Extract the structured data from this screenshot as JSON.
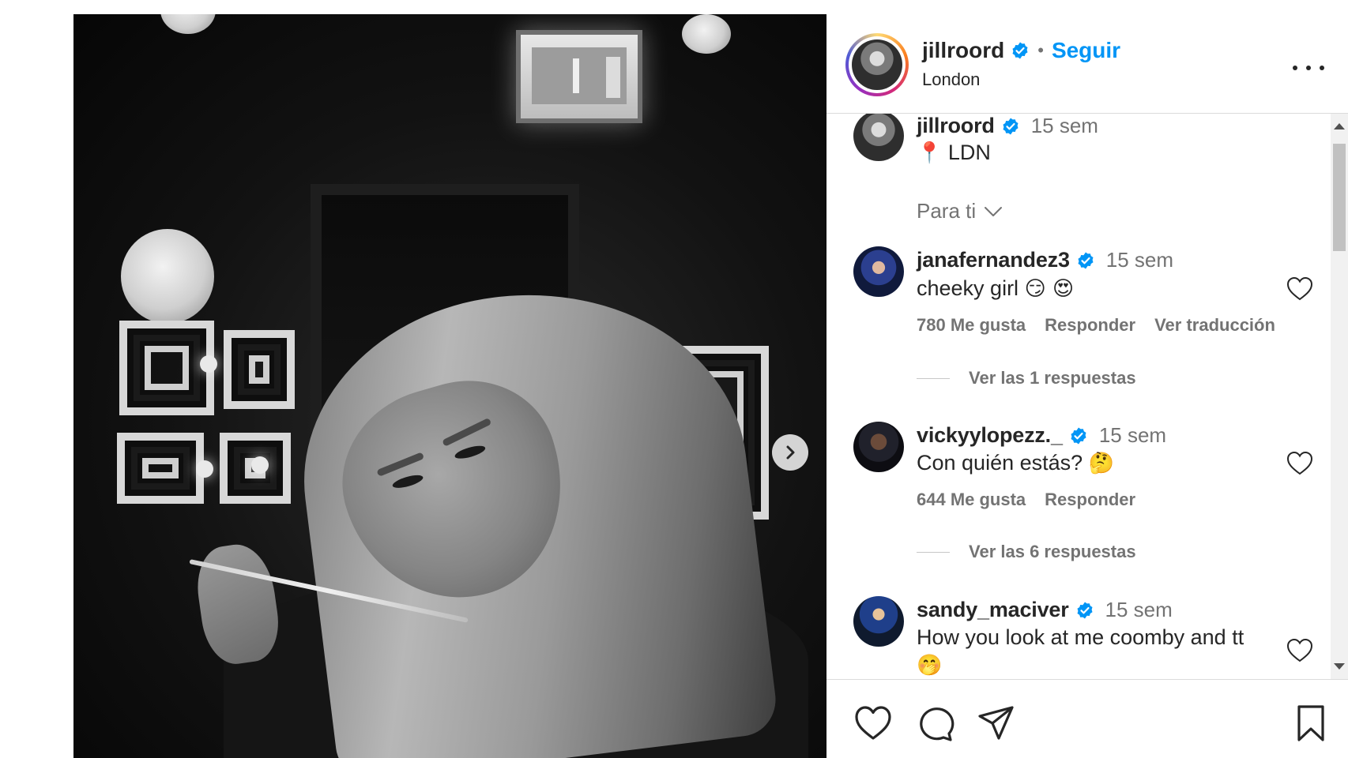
{
  "post": {
    "username": "jillroord",
    "follow_label": "Seguir",
    "location": "London",
    "separator": "•"
  },
  "caption": {
    "username": "jillroord",
    "time": "15 sem",
    "pin_glyph": "📍",
    "text": "LDN"
  },
  "sort": {
    "label": "Para ti"
  },
  "comments": [
    {
      "username": "janafernandez3",
      "time": "15 sem",
      "text": "cheeky girl",
      "emojis": "😏 😍",
      "likes": "780 Me gusta",
      "reply_label": "Responder",
      "translate_label": "Ver traducción",
      "replies_label": "Ver las 1 respuestas"
    },
    {
      "username": "vickyylopezz._",
      "time": "15 sem",
      "text": "Con quién estás?",
      "emojis": "🤔",
      "likes": "644 Me gusta",
      "reply_label": "Responder",
      "replies_label": "Ver las 6 respuestas"
    },
    {
      "username": "sandy_maciver",
      "time": "15 sem",
      "text": "How you look at me coomby and tt",
      "emojis": "🤭"
    }
  ],
  "icons": {
    "verified": "verified-badge-icon",
    "more": "more-options-icon",
    "next": "chevron-right-icon",
    "like": "heart-icon",
    "comment": "comment-bubble-icon",
    "share": "paper-plane-icon",
    "save": "bookmark-icon"
  },
  "colors": {
    "accent": "#0095f6",
    "text": "#262626",
    "muted": "#737373",
    "border": "#dbdbdb"
  }
}
